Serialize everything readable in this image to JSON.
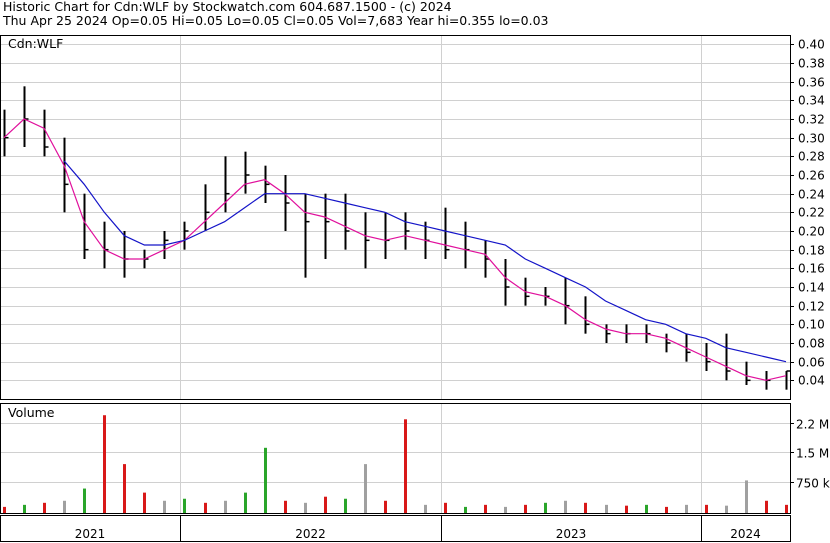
{
  "header": {
    "line1": "Historic Chart for Cdn:WLF by Stockwatch.com 604.687.1500 - (c) 2024",
    "line2": "Thu Apr 25 2024  Op=0.05  Hi=0.05  Lo=0.05  Cl=0.05  Vol=7,683  Year hi=0.355  lo=0.03"
  },
  "chart_data": {
    "type": "line",
    "title": "",
    "symbol_label": "Cdn:WLF",
    "volume_label": "Volume",
    "price_axis": {
      "ticks": [
        "0.40",
        "0.38",
        "0.36",
        "0.34",
        "0.32",
        "0.30",
        "0.28",
        "0.26",
        "0.24",
        "0.22",
        "0.20",
        "0.18",
        "0.16",
        "0.14",
        "0.12",
        "0.10",
        "0.08",
        "0.06",
        "0.04"
      ],
      "ylim": [
        0.02,
        0.41
      ]
    },
    "volume_axis": {
      "ticks": [
        "2.2 M",
        "1.5 M",
        "750 k"
      ],
      "ylim": [
        0,
        2700000
      ]
    },
    "year_labels": [
      "2021",
      "2022",
      "2023",
      "2024"
    ],
    "grid": true,
    "colors": {
      "price_bar": "#000000",
      "ma_short": "#e0109c",
      "ma_long": "#1414c8",
      "vol_up": "#2aa52a",
      "vol_down": "#d81818",
      "vol_flat": "#a0a0a0",
      "grid": "#d0d0d0"
    },
    "x": [
      "2021-01",
      "2021-02",
      "2021-03",
      "2021-04",
      "2021-05",
      "2021-06",
      "2021-07",
      "2021-08",
      "2021-09",
      "2021-10",
      "2021-11",
      "2021-12",
      "2022-01",
      "2022-02",
      "2022-03",
      "2022-04",
      "2022-05",
      "2022-06",
      "2022-07",
      "2022-08",
      "2022-09",
      "2022-10",
      "2022-11",
      "2022-12",
      "2023-01",
      "2023-02",
      "2023-03",
      "2023-04",
      "2023-05",
      "2023-06",
      "2023-07",
      "2023-08",
      "2023-09",
      "2023-10",
      "2023-11",
      "2023-12",
      "2024-01",
      "2024-02",
      "2024-03",
      "2024-04"
    ],
    "series": [
      {
        "type": "ohlc",
        "high": [
          0.33,
          0.355,
          0.33,
          0.3,
          0.24,
          0.21,
          0.2,
          0.18,
          0.2,
          0.21,
          0.25,
          0.28,
          0.285,
          0.27,
          0.26,
          0.24,
          0.24,
          0.24,
          0.22,
          0.22,
          0.22,
          0.21,
          0.225,
          0.21,
          0.19,
          0.17,
          0.15,
          0.14,
          0.15,
          0.13,
          0.1,
          0.1,
          0.1,
          0.09,
          0.09,
          0.08,
          0.09,
          0.06,
          0.05,
          0.05
        ],
        "low": [
          0.28,
          0.29,
          0.28,
          0.22,
          0.17,
          0.16,
          0.15,
          0.16,
          0.17,
          0.18,
          0.2,
          0.22,
          0.24,
          0.23,
          0.2,
          0.15,
          0.17,
          0.18,
          0.16,
          0.17,
          0.18,
          0.17,
          0.17,
          0.16,
          0.15,
          0.12,
          0.12,
          0.12,
          0.1,
          0.09,
          0.08,
          0.08,
          0.08,
          0.07,
          0.06,
          0.05,
          0.04,
          0.035,
          0.03,
          0.03
        ],
        "close": [
          0.3,
          0.32,
          0.29,
          0.25,
          0.18,
          0.18,
          0.17,
          0.17,
          0.19,
          0.2,
          0.22,
          0.24,
          0.26,
          0.25,
          0.23,
          0.21,
          0.21,
          0.2,
          0.19,
          0.19,
          0.2,
          0.19,
          0.18,
          0.18,
          0.17,
          0.14,
          0.13,
          0.13,
          0.12,
          0.1,
          0.09,
          0.09,
          0.09,
          0.08,
          0.07,
          0.06,
          0.05,
          0.04,
          0.04,
          0.05
        ]
      },
      {
        "type": "ma_short",
        "values": [
          0.3,
          0.32,
          0.31,
          0.27,
          0.21,
          0.18,
          0.17,
          0.17,
          0.18,
          0.19,
          0.21,
          0.23,
          0.25,
          0.255,
          0.24,
          0.22,
          0.215,
          0.205,
          0.195,
          0.19,
          0.195,
          0.19,
          0.185,
          0.18,
          0.175,
          0.15,
          0.135,
          0.13,
          0.12,
          0.105,
          0.095,
          0.09,
          0.09,
          0.085,
          0.075,
          0.065,
          0.055,
          0.045,
          0.04,
          0.045
        ]
      },
      {
        "type": "ma_long",
        "values": [
          null,
          null,
          null,
          0.275,
          0.25,
          0.22,
          0.195,
          0.185,
          0.185,
          0.19,
          0.2,
          0.21,
          0.225,
          0.24,
          0.24,
          0.24,
          0.235,
          0.23,
          0.225,
          0.22,
          0.21,
          0.205,
          0.2,
          0.195,
          0.19,
          0.185,
          0.17,
          0.16,
          0.15,
          0.14,
          0.125,
          0.115,
          0.105,
          0.1,
          0.09,
          0.085,
          0.075,
          0.07,
          0.065,
          0.06
        ]
      }
    ],
    "volume": [
      0.15,
      0.2,
      0.25,
      0.3,
      0.6,
      2.4,
      1.2,
      0.5,
      0.3,
      0.35,
      0.25,
      0.3,
      0.5,
      1.6,
      0.3,
      0.25,
      0.4,
      0.35,
      1.2,
      0.3,
      2.3,
      0.2,
      0.25,
      0.15,
      0.2,
      0.15,
      0.2,
      0.25,
      0.3,
      0.25,
      0.2,
      0.18,
      0.2,
      0.15,
      0.2,
      0.2,
      0.18,
      0.8,
      0.3,
      0.2
    ],
    "volume_colors": [
      "down",
      "up",
      "down",
      "flat",
      "up",
      "down",
      "down",
      "down",
      "flat",
      "up",
      "down",
      "flat",
      "up",
      "up",
      "down",
      "flat",
      "down",
      "up",
      "flat",
      "down",
      "down",
      "flat",
      "down",
      "up",
      "down",
      "flat",
      "down",
      "up",
      "flat",
      "down",
      "flat",
      "down",
      "up",
      "down",
      "flat",
      "down",
      "flat",
      "flat",
      "down",
      "down"
    ]
  }
}
